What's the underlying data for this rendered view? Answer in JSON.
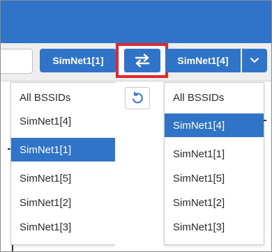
{
  "colors": {
    "accent": "#2f74c8",
    "highlight_border": "#e0282c",
    "selected_text": "#ffffff"
  },
  "toolbar": {
    "left_selector_label": "SimNet1[1]",
    "right_selector_label": "SimNet1[4]",
    "swap_icon": "swap-arrows-icon",
    "dropdown_icon": "chevron-down-icon"
  },
  "left_list": {
    "items": [
      {
        "label": "All BSSIDs",
        "selected": false
      },
      {
        "label": "SimNet1[4]",
        "selected": false
      },
      {
        "label": "SimNet1[1]",
        "selected": true
      },
      {
        "label": "SimNet1[5]",
        "selected": false
      },
      {
        "label": "SimNet1[2]",
        "selected": false
      },
      {
        "label": "SimNet1[3]",
        "selected": false
      }
    ]
  },
  "right_list": {
    "items": [
      {
        "label": "All BSSIDs",
        "selected": false
      },
      {
        "label": "SimNet1[4]",
        "selected": true
      },
      {
        "label": "SimNet1[1]",
        "selected": false
      },
      {
        "label": "SimNet1[5]",
        "selected": false
      },
      {
        "label": "SimNet1[2]",
        "selected": false
      },
      {
        "label": "SimNet1[3]",
        "selected": false
      }
    ]
  },
  "reset_icon": "reset-icon"
}
